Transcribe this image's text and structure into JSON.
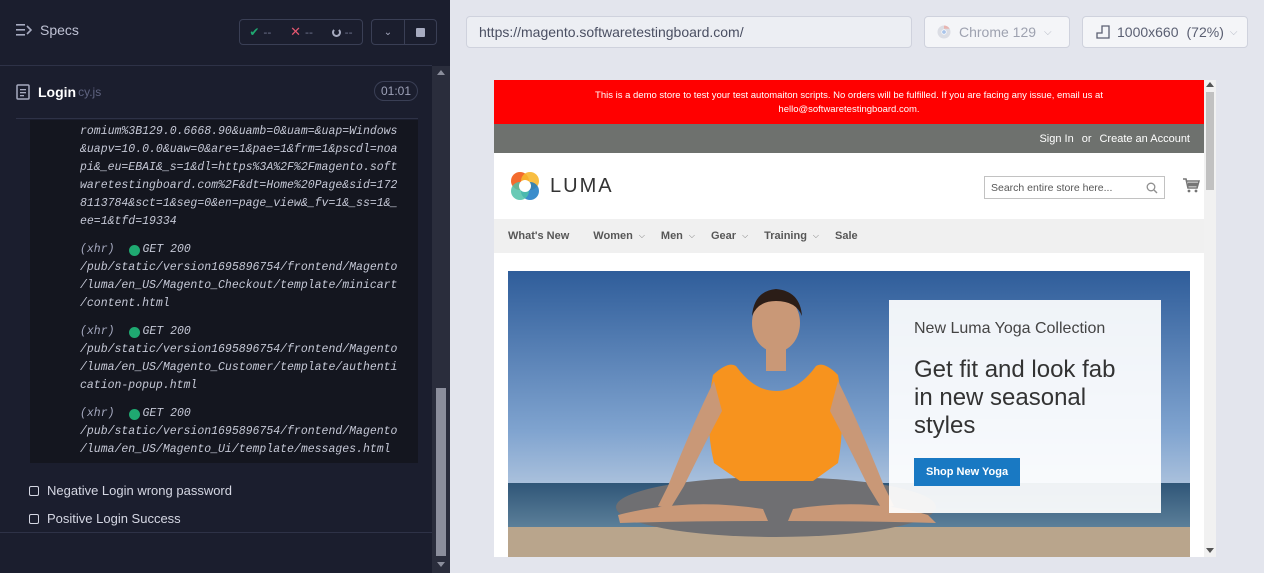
{
  "reporter": {
    "specs_label": "Specs",
    "stats": {
      "passed": "--",
      "failed": "--",
      "pending": "--"
    },
    "spec": {
      "name": "Login",
      "ext": "cy.js",
      "duration": "01:01"
    },
    "log_lines": [
      "romium%3B129.0.6668.90&uamb=0&uam=&uap=Windows",
      "&uapv=10.0.0&uaw=0&are=1&pae=1&frm=1&pscdl=noa",
      "pi&_eu=EBAI&_s=1&dl=https%3A%2F%2Fmagento.soft",
      "waretestingboard.com%2F&dt=Home%20Page&sid=172",
      "8113784&sct=1&seg=0&en=page_view&_fv=1&_ss=1&_",
      "ee=1&tfd=19334"
    ],
    "requests": [
      {
        "kind": "(xhr)",
        "method_status": "GET 200",
        "lines": [
          "/pub/static/version1695896754/frontend/Magento",
          "/luma/en_US/Magento_Checkout/template/minicart",
          "/content.html"
        ]
      },
      {
        "kind": "(xhr)",
        "method_status": "GET 200",
        "lines": [
          "/pub/static/version1695896754/frontend/Magento",
          "/luma/en_US/Magento_Customer/template/authenti",
          "cation-popup.html"
        ]
      },
      {
        "kind": "(xhr)",
        "method_status": "GET 200",
        "lines": [
          "/pub/static/version1695896754/frontend/Magento",
          "/luma/en_US/Magento_Ui/template/messages.html"
        ]
      }
    ],
    "tests": [
      "Negative Login wrong password",
      "Positive Login Success"
    ]
  },
  "aut": {
    "url": "https://magento.softwaretestingboard.com/",
    "browser": "Chrome 129",
    "viewport": "1000x660",
    "scale": "(72%)"
  },
  "store": {
    "demo_notice_line1": "This is a demo store to test your test automaiton scripts. No orders will be fulfilled. If you are facing any issue, email us at",
    "demo_notice_line2": "hello@softwaretestingboard.com.",
    "sign_in": "Sign In",
    "or": "or",
    "create_account": "Create an Account",
    "logo_text": "LUMA",
    "search_placeholder": "Search entire store here...",
    "nav": [
      "What's New",
      "Women",
      "Men",
      "Gear",
      "Training",
      "Sale"
    ],
    "nav_has_menu": [
      false,
      true,
      true,
      true,
      true,
      false
    ],
    "promo": {
      "kicker": "New Luma Yoga Collection",
      "title_line1": "Get fit and look fab",
      "title_line2": "in new seasonal",
      "title_line3": "styles",
      "button": "Shop New Yoga"
    }
  },
  "colors": {
    "reporter_bg": "#1b1e2e",
    "passed": "#1fa971",
    "failed": "#e45770",
    "demo_banner": "#ff0000",
    "brand_button": "#1979c3"
  }
}
